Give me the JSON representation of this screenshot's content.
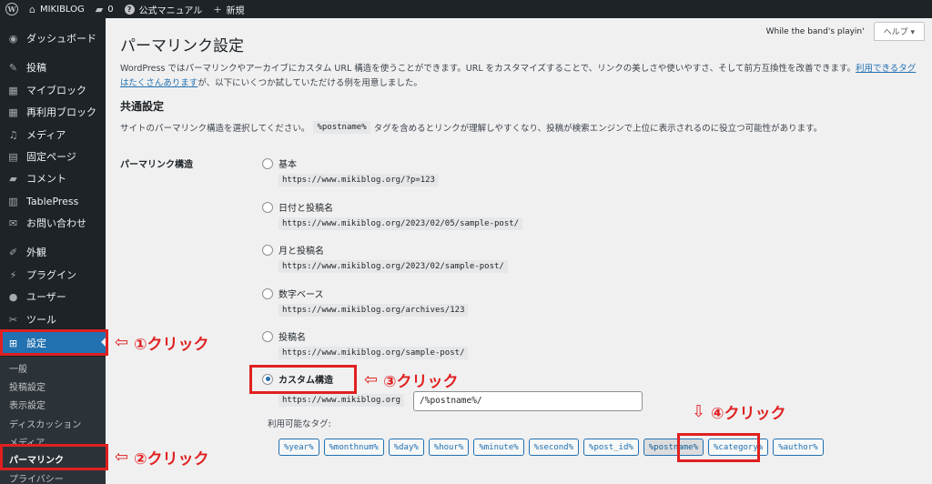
{
  "adminbar": {
    "logo": "W",
    "logo_icon": "wordpress-logo",
    "site_name": "MIKIBLOG",
    "comments_count": "0",
    "manual": "公式マニュアル",
    "new": "新規"
  },
  "sidebar": {
    "items": [
      {
        "label": "ダッシュボード",
        "icon": "dashboard-icon",
        "glyph": "◉"
      },
      {
        "label": "投稿",
        "icon": "pin-icon",
        "glyph": "✎"
      },
      {
        "label": "マイブロック",
        "icon": "blocks-icon",
        "glyph": "▦"
      },
      {
        "label": "再利用ブロック",
        "icon": "reusable-blocks-icon",
        "glyph": "▦"
      },
      {
        "label": "メディア",
        "icon": "media-icon",
        "glyph": "♫"
      },
      {
        "label": "固定ページ",
        "icon": "page-icon",
        "glyph": "▤"
      },
      {
        "label": "コメント",
        "icon": "comment-icon",
        "glyph": "▰"
      },
      {
        "label": "TablePress",
        "icon": "table-icon",
        "glyph": "▥"
      },
      {
        "label": "お問い合わせ",
        "icon": "mail-icon",
        "glyph": "✉"
      },
      {
        "label": "外観",
        "icon": "brush-icon",
        "glyph": "✐"
      },
      {
        "label": "プラグイン",
        "icon": "plugin-icon",
        "glyph": "⚡"
      },
      {
        "label": "ユーザー",
        "icon": "user-icon",
        "glyph": "●"
      },
      {
        "label": "ツール",
        "icon": "wrench-icon",
        "glyph": "✂"
      },
      {
        "label": "設定",
        "icon": "settings-icon",
        "glyph": "⊞"
      }
    ],
    "submenu": [
      "一般",
      "投稿設定",
      "表示設定",
      "ディスカッション",
      "メディア",
      "パーマリンク",
      "プライバシー"
    ]
  },
  "screen_meta": {
    "now_playing": "While the band's playin'",
    "help": "ヘルプ ▾"
  },
  "page": {
    "title": "パーマリンク設定",
    "intro_text": "WordPress ではパーマリンクやアーカイブにカスタム URL 構造を使うことができます。URL をカスタマイズすることで、リンクの美しさや使いやすさ、そして前方互換性を改善できます。",
    "intro_link": "利用できるタグはたくさんあります",
    "intro_text2": "が、以下にいくつか試していただける例を用意しました。",
    "section_title": "共通設定",
    "section_desc_before": "サイトのパーマリンク構造を選択してください。",
    "section_desc_code": "%postname%",
    "section_desc_after": "タグを含めるとリンクが理解しやすくなり、投稿が検索エンジンで上位に表示されるのに役立つ可能性があります。",
    "field_label": "パーマリンク構造",
    "options": [
      {
        "label": "基本",
        "url": "https://www.mikiblog.org/?p=123"
      },
      {
        "label": "日付と投稿名",
        "url": "https://www.mikiblog.org/2023/02/05/sample-post/"
      },
      {
        "label": "月と投稿名",
        "url": "https://www.mikiblog.org/2023/02/sample-post/"
      },
      {
        "label": "数字ベース",
        "url": "https://www.mikiblog.org/archives/123"
      },
      {
        "label": "投稿名",
        "url": "https://www.mikiblog.org/sample-post/"
      },
      {
        "label": "カスタム構造"
      }
    ],
    "custom_prefix": "https://www.mikiblog.org",
    "custom_value": "/%postname%/",
    "tags_label": "利用可能なタグ:",
    "tags": [
      "%year%",
      "%monthnum%",
      "%day%",
      "%hour%",
      "%minute%",
      "%second%",
      "%post_id%",
      "%postname%",
      "%category%",
      "%author%"
    ]
  },
  "annotations": {
    "a1": "①クリック",
    "a2": "②クリック",
    "a3": "③クリック",
    "a4": "④クリック",
    "arrow_left": "⇦",
    "arrow_down": "⇩"
  },
  "colors": {
    "accent": "#2271b1",
    "sidebar_bg": "#1d2327",
    "annotation_red": "#e02020"
  }
}
